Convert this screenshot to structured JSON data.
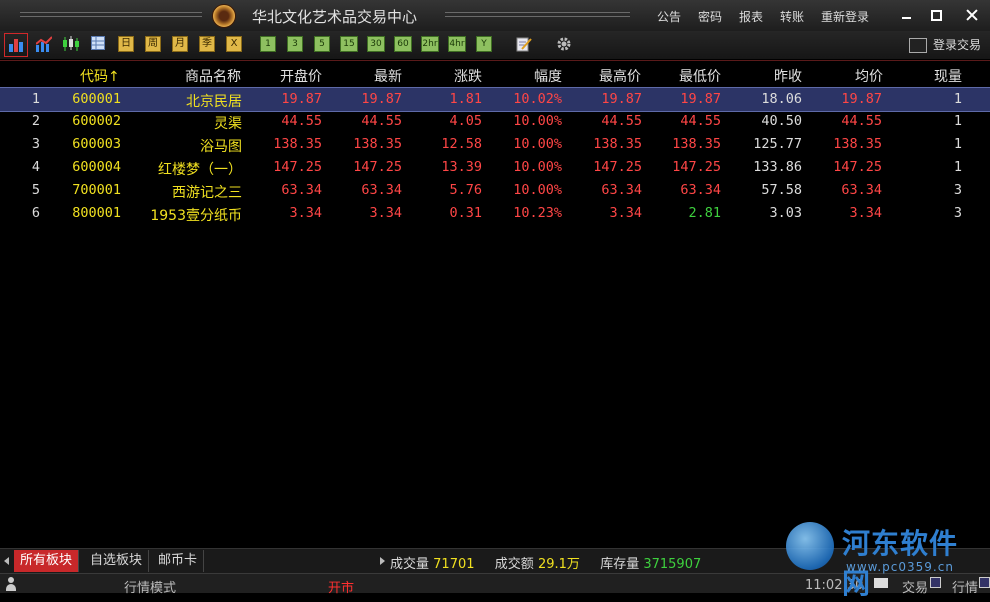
{
  "window": {
    "title": "华北文化艺术品交易中心",
    "menu": [
      "公告",
      "密码",
      "报表",
      "转账",
      "重新登录"
    ]
  },
  "toolbar": {
    "period_buttons": [
      "日",
      "周",
      "月",
      "季",
      "X"
    ],
    "minute_buttons": [
      "1",
      "3",
      "5",
      "15",
      "30",
      "60",
      "2hr",
      "4hr",
      "Y"
    ],
    "login_trade_label": "登录交易"
  },
  "table": {
    "headers": [
      "代码",
      "商品名称",
      "开盘价",
      "最新",
      "涨跌",
      "幅度",
      "最高价",
      "最低价",
      "昨收",
      "均价",
      "现量"
    ],
    "sort_column": "代码",
    "sort_indicator": "↑",
    "rows": [
      {
        "idx": "1",
        "code": "600001",
        "name": "北京民居",
        "open": "19.87",
        "last": "19.87",
        "change": "1.81",
        "pct": "10.02%",
        "high": "19.87",
        "low": "19.87",
        "prev": "18.06",
        "avg": "19.87",
        "vol": "1"
      },
      {
        "idx": "2",
        "code": "600002",
        "name": "灵渠",
        "open": "44.55",
        "last": "44.55",
        "change": "4.05",
        "pct": "10.00%",
        "high": "44.55",
        "low": "44.55",
        "prev": "40.50",
        "avg": "44.55",
        "vol": "1"
      },
      {
        "idx": "3",
        "code": "600003",
        "name": "浴马图",
        "open": "138.35",
        "last": "138.35",
        "change": "12.58",
        "pct": "10.00%",
        "high": "138.35",
        "low": "138.35",
        "prev": "125.77",
        "avg": "138.35",
        "vol": "1"
      },
      {
        "idx": "4",
        "code": "600004",
        "name": "红楼梦（一）",
        "open": "147.25",
        "last": "147.25",
        "change": "13.39",
        "pct": "10.00%",
        "high": "147.25",
        "low": "147.25",
        "prev": "133.86",
        "avg": "147.25",
        "vol": "1"
      },
      {
        "idx": "5",
        "code": "700001",
        "name": "西游记之三",
        "open": "63.34",
        "last": "63.34",
        "change": "5.76",
        "pct": "10.00%",
        "high": "63.34",
        "low": "63.34",
        "prev": "57.58",
        "avg": "63.34",
        "vol": "3"
      },
      {
        "idx": "6",
        "code": "800001",
        "name": "1953壹分纸币",
        "open": "3.34",
        "last": "3.34",
        "change": "0.31",
        "pct": "10.23%",
        "high": "3.34",
        "low": "2.81",
        "prev": "3.03",
        "avg": "3.34",
        "vol": "3"
      }
    ]
  },
  "bottom": {
    "tabs": [
      "所有板块",
      "自选板块",
      "邮币卡"
    ],
    "stats": {
      "volume_label": "成交量",
      "volume_value": "71701",
      "amount_label": "成交额",
      "amount_value": "29.1万",
      "stock_label": "库存量",
      "stock_value": "3715907"
    }
  },
  "status": {
    "mode": "行情模式",
    "market": "开市",
    "time": "11:02:30",
    "trade": "交易",
    "quote": "行情"
  },
  "watermark": {
    "text": "河东软件网",
    "url": "www.pc0359.cn"
  },
  "colors": {
    "up": "#ff4646",
    "down": "#3ed03e",
    "code": "#f0e020",
    "selected_row": "#2c3466",
    "active_tab": "#c8282a"
  }
}
